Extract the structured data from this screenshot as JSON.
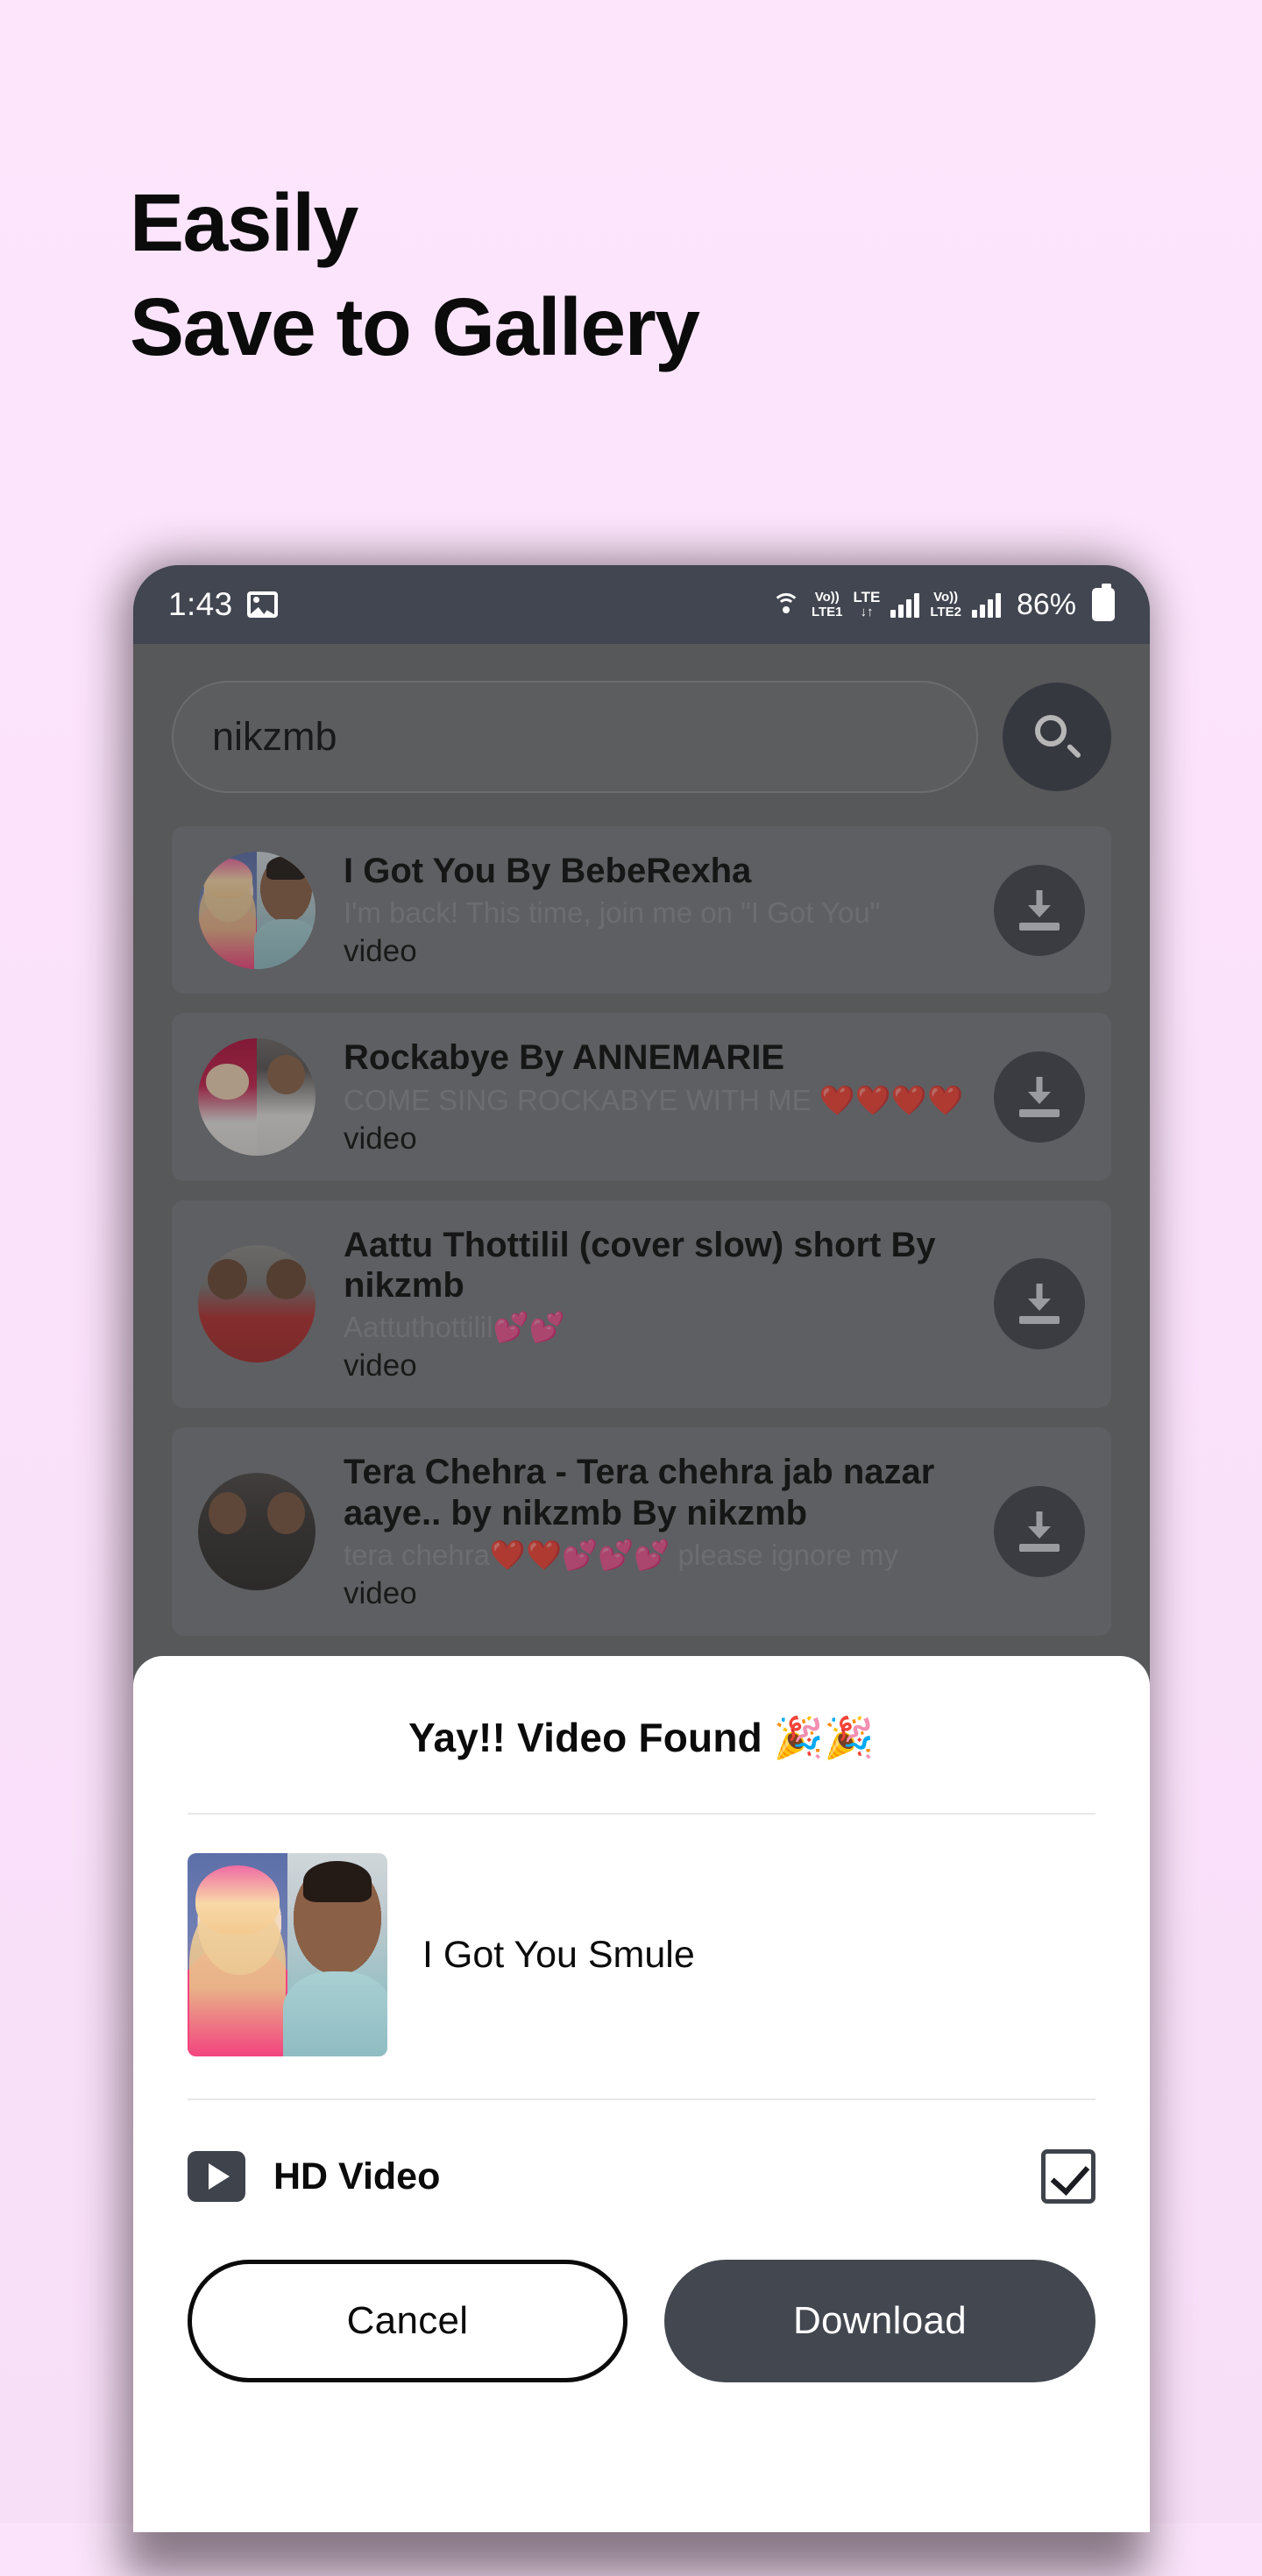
{
  "promo": {
    "headline": "Easily\nSave to Gallery",
    "background_color": "#fbe4fb"
  },
  "statusbar": {
    "time": "1:43",
    "gallery_icon": "gallery-icon",
    "wifi_icon": "wifi-icon",
    "volte1_label_a": "Vo))",
    "volte1_label_b": "LTE1",
    "lte_label": "LTE",
    "lte_sub": "↓↑",
    "volte2_label_a": "Vo))",
    "volte2_label_b": "LTE2",
    "battery_percent": "86%",
    "battery_icon": "battery-icon"
  },
  "search": {
    "value": "nikzmb",
    "placeholder": "nikzmb",
    "button_icon": "search-icon"
  },
  "results": [
    {
      "title": "I Got You By BebeRexha",
      "subtitle": "I'm back! This time, join me on \"I Got You\"",
      "kind": "video",
      "download_icon": "download-icon",
      "avatar_left": "p-blonde",
      "avatar_right": "p-man"
    },
    {
      "title": "Rockabye By ANNEMARIE",
      "subtitle": "COME SING ROCKABYE WITH ME ❤️❤️❤️❤️",
      "kind": "video",
      "download_icon": "download-icon",
      "avatar_left": "p-red",
      "avatar_right": "p-gray"
    },
    {
      "title": "Aattu Thottilil (cover slow) short By nikzmb",
      "subtitle": "Aattuthottilil💕💕",
      "kind": "video",
      "download_icon": "download-icon",
      "avatar_left": "p-room",
      "avatar_right": "p-room"
    },
    {
      "title": "Tera Chehra - Tera chehra jab nazar aaye.. by nikzmb By nikzmb",
      "subtitle": "tera chehra❤️❤️💕💕💕 please ignore my",
      "kind": "video",
      "download_icon": "download-icon",
      "avatar_left": "p-dark",
      "avatar_right": "p-dark"
    }
  ],
  "sheet": {
    "title": "Yay!!  Video Found  🎉🎉",
    "found_video_name": "I Got You Smule",
    "thumbnail_left": "p-blonde",
    "thumbnail_right": "p-man",
    "option_label": "HD Video",
    "option_icon": "play-video-icon",
    "option_checked": true,
    "cancel_label": "Cancel",
    "download_label": "Download",
    "accent_dark": "#434750"
  }
}
